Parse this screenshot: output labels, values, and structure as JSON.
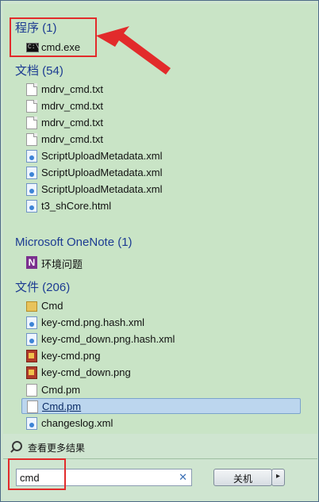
{
  "groups": {
    "programs": {
      "title": "程序 (1)",
      "items": [
        {
          "label": "cmd.exe",
          "icon": "cmd-icon"
        }
      ]
    },
    "documents": {
      "title": "文档 (54)",
      "items": [
        {
          "label": "mdrv_cmd.txt",
          "icon": "text-file-icon"
        },
        {
          "label": "mdrv_cmd.txt",
          "icon": "text-file-icon"
        },
        {
          "label": "mdrv_cmd.txt",
          "icon": "text-file-icon"
        },
        {
          "label": "mdrv_cmd.txt",
          "icon": "text-file-icon"
        },
        {
          "label": "ScriptUploadMetadata.xml",
          "icon": "xml-file-icon"
        },
        {
          "label": "ScriptUploadMetadata.xml",
          "icon": "xml-file-icon"
        },
        {
          "label": "ScriptUploadMetadata.xml",
          "icon": "xml-file-icon"
        },
        {
          "label": "t3_shCore.html",
          "icon": "html-file-icon"
        }
      ]
    },
    "onenote": {
      "title": "Microsoft OneNote (1)",
      "items": [
        {
          "label": "环境问题",
          "icon": "onenote-icon"
        }
      ]
    },
    "files": {
      "title": "文件 (206)",
      "items": [
        {
          "label": "Cmd",
          "icon": "folder-icon"
        },
        {
          "label": "key-cmd.png.hash.xml",
          "icon": "xml-file-icon"
        },
        {
          "label": "key-cmd_down.png.hash.xml",
          "icon": "xml-file-icon"
        },
        {
          "label": "key-cmd.png",
          "icon": "image-file-icon"
        },
        {
          "label": "key-cmd_down.png",
          "icon": "image-file-icon"
        },
        {
          "label": "Cmd.pm",
          "icon": "file-icon"
        },
        {
          "label": "Cmd.pm",
          "icon": "file-icon",
          "selected": true
        },
        {
          "label": "changeslog.xml",
          "icon": "xml-file-icon"
        }
      ]
    }
  },
  "see_more": {
    "label": "查看更多结果",
    "icon": "search-icon"
  },
  "search": {
    "value": "cmd",
    "clear_icon": "close-icon"
  },
  "shutdown": {
    "label": "关机",
    "arrow": "▸"
  },
  "colors": {
    "annotation": "#e22b2b",
    "group_title": "#1c3b92",
    "selection": "#bcd6ee"
  }
}
